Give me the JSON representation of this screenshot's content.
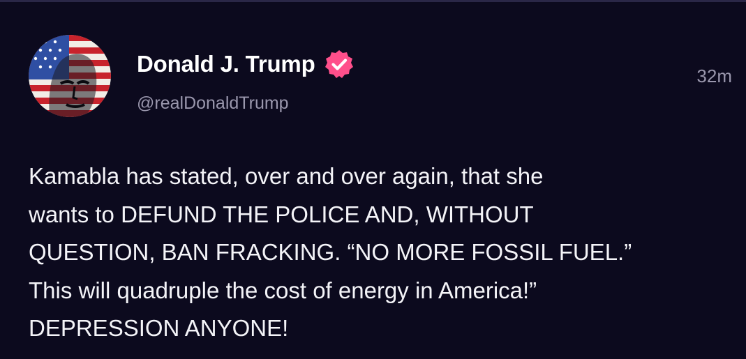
{
  "post": {
    "author": {
      "display_name": "Donald J. Trump",
      "handle": "@realDonaldTrump",
      "verified_icon": "verified-badge-icon",
      "verified_color": "#ff4f8b"
    },
    "timestamp": "32m",
    "body_lines": [
      "Kamabla has stated, over and over again, that she",
      "wants to DEFUND THE POLICE AND, WITHOUT",
      "QUESTION, BAN FRACKING. “NO MORE FOSSIL FUEL.”",
      "This will quadruple the cost of energy in America!”",
      "DEPRESSION ANYONE!"
    ]
  },
  "theme": {
    "background": "#0c0a1e",
    "text_primary": "#ffffff",
    "text_secondary": "#9a97ad"
  }
}
